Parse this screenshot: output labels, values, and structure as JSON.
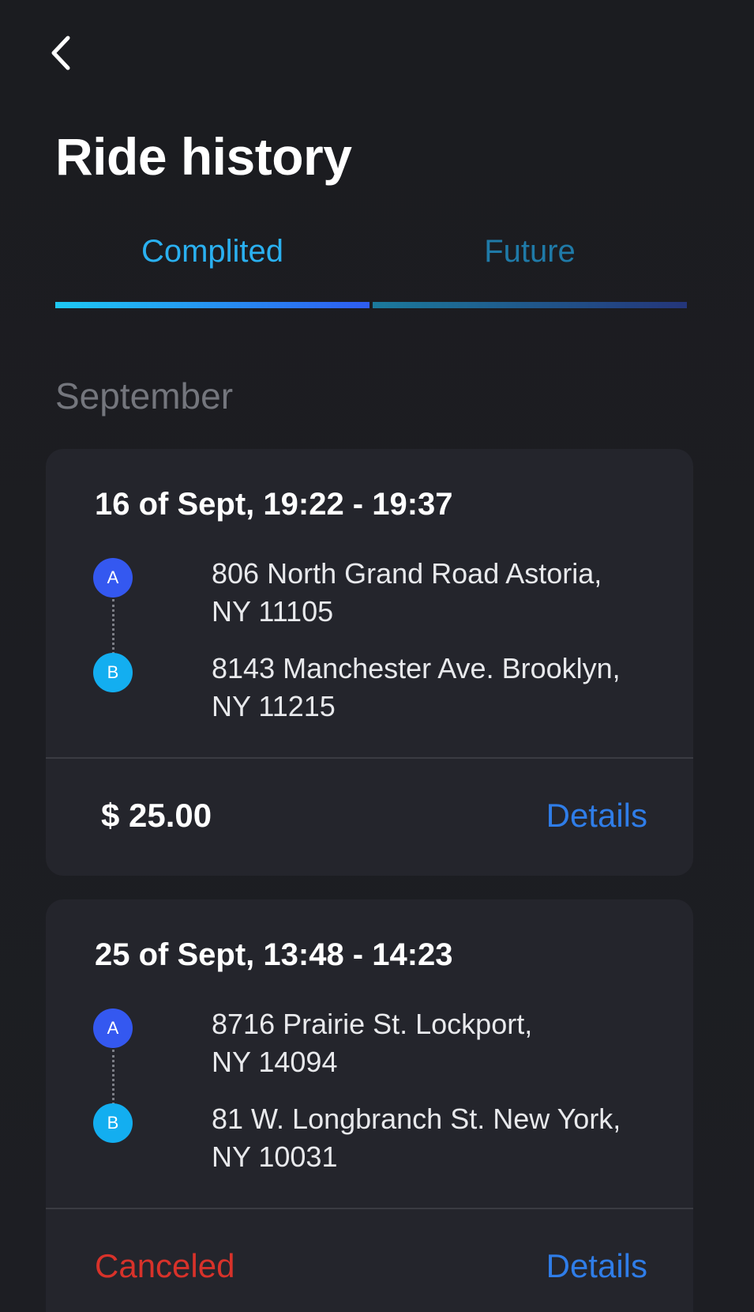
{
  "header": {
    "back_icon": "chevron-left-icon",
    "title": "Ride history"
  },
  "tabs": [
    {
      "label": "Complited",
      "active": true
    },
    {
      "label": "Future",
      "active": false
    }
  ],
  "colors": {
    "accent": "#2ab0f0",
    "link": "#2f7de8",
    "canceled": "#d8322a",
    "marker_a": "#3458f0",
    "marker_b": "#13aef0"
  },
  "section": {
    "month": "September"
  },
  "rides": [
    {
      "time": "16 of Sept, 19:22 - 19:37",
      "from_marker": "A",
      "from": "806 North Grand Road Astoria,\nNY 11105",
      "to_marker": "B",
      "to": "8143 Manchester Ave. Brooklyn,\nNY 11215",
      "footer_left": "$ 25.00",
      "details_label": "Details"
    },
    {
      "time": "25 of Sept, 13:48 - 14:23",
      "from_marker": "A",
      "from": "8716 Prairie St. Lockport,\nNY 14094",
      "to_marker": "B",
      "to": "81 W. Longbranch St. New York,\nNY 10031",
      "footer_left": "Canceled",
      "details_label": "Details"
    }
  ]
}
